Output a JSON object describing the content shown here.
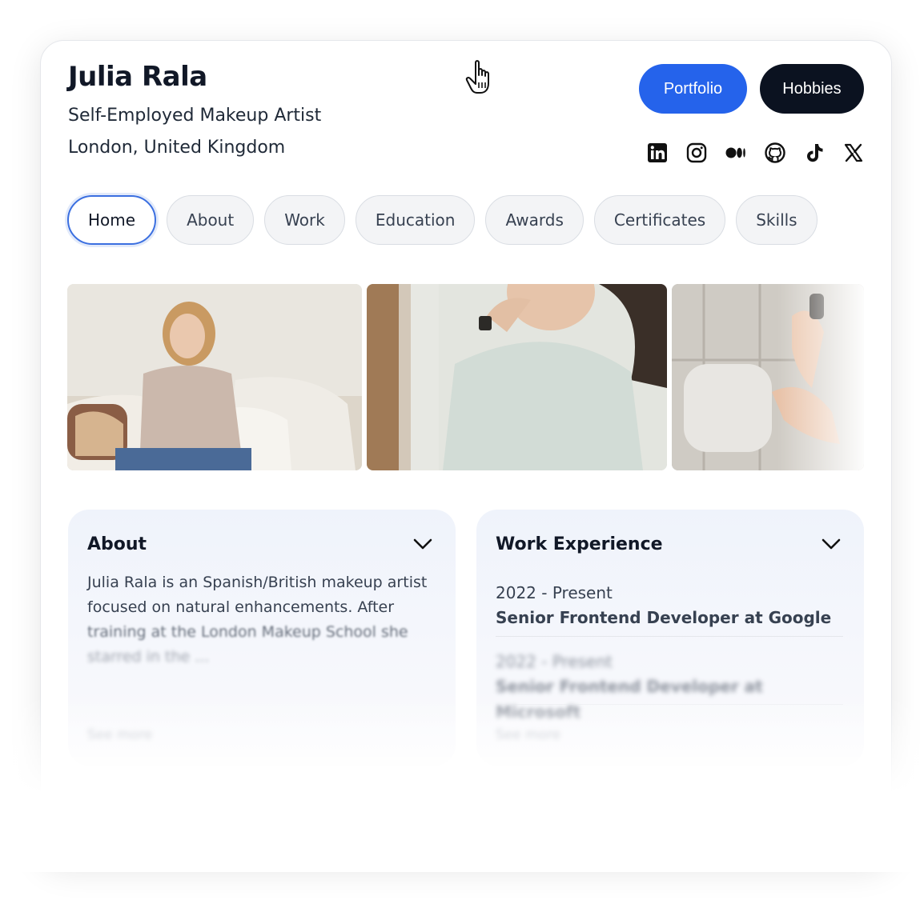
{
  "profile": {
    "name": "Julia Rala",
    "role": "Self-Employed Makeup Artist",
    "location": "London, United Kingdom"
  },
  "buttons": {
    "portfolio": "Portfolio",
    "hobbies": "Hobbies"
  },
  "socials": [
    "linkedin-icon",
    "instagram-icon",
    "medium-icon",
    "github-icon",
    "tiktok-icon",
    "x-icon"
  ],
  "tabs": [
    {
      "label": "Home",
      "active": true
    },
    {
      "label": "About",
      "active": false
    },
    {
      "label": "Work",
      "active": false
    },
    {
      "label": "Education",
      "active": false
    },
    {
      "label": "Awards",
      "active": false
    },
    {
      "label": "Certificates",
      "active": false
    },
    {
      "label": "Skills",
      "active": false
    }
  ],
  "about": {
    "title": "About",
    "lines": [
      "Julia Rala is an Spanish/British makeup artist",
      "focused on natural enhancements. After",
      "training at the London Makeup School she",
      "starred in the ..."
    ],
    "see_more": "See more"
  },
  "work": {
    "title": "Work Experience",
    "jobs": [
      {
        "years": "2022 - Present",
        "title": "Senior Frontend Developer at Google"
      },
      {
        "years": "2022 - Present",
        "title": "Senior Frontend Developer at Microsoft"
      }
    ],
    "see_more": "See more"
  },
  "colors": {
    "accent": "#2563eb",
    "dark": "#0b1220",
    "panel_bg": "#eff3fb"
  }
}
